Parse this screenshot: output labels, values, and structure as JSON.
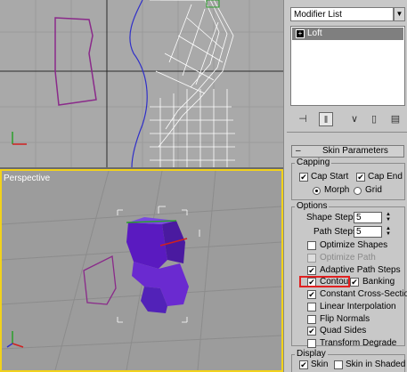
{
  "viewports": {
    "top_label": "",
    "perspective_label": "Perspective"
  },
  "panel": {
    "modifier_list": "Modifier List",
    "stack_item": "Loft",
    "stack_expand": "+",
    "toolbar": [
      "pin-stack-icon",
      "show-end-result-icon",
      "make-unique-icon",
      "remove-modifier-icon",
      "configure-sets-icon"
    ],
    "rollout_minus": "–",
    "rollout_title": "Skin Parameters",
    "capping": {
      "title": "Capping",
      "cap_start": "Cap Start",
      "cap_end": "Cap End",
      "morph": "Morph",
      "grid": "Grid"
    },
    "options": {
      "title": "Options",
      "shape_steps_label": "Shape Steps:",
      "shape_steps_value": "5",
      "path_steps_label": "Path Steps:",
      "path_steps_value": "5",
      "optimize_shapes": "Optimize Shapes",
      "optimize_path": "Optimize Path",
      "adaptive_path_steps": "Adaptive Path Steps",
      "contour": "Contour",
      "banking": "Banking",
      "constant_cross_section": "Constant Cross-Section",
      "linear_interpolation": "Linear Interpolation",
      "flip_normals": "Flip Normals",
      "quad_sides": "Quad Sides",
      "transform_degrade": "Transform Degrade"
    },
    "display": {
      "title": "Display",
      "skin": "Skin",
      "skin_in_shaded": "Skin in Shaded"
    }
  },
  "states": {
    "cap_start": true,
    "cap_end": true,
    "morph_selected": true,
    "optimize_shapes": false,
    "optimize_path": false,
    "adaptive_path_steps": true,
    "contour": true,
    "banking": true,
    "constant_cross_section": true,
    "linear_interpolation": false,
    "flip_normals": false,
    "quad_sides": true,
    "transform_degrade": false,
    "skin": true,
    "skin_in_shaded": false
  },
  "colors": {
    "viewport_bg": "#a9a9a9",
    "active_border": "#f2d21b",
    "highlight": "#e02020",
    "shape_purple": "#8a2a8a",
    "path_blue": "#3030c8",
    "mesh_purple": "#6a2ad0"
  }
}
